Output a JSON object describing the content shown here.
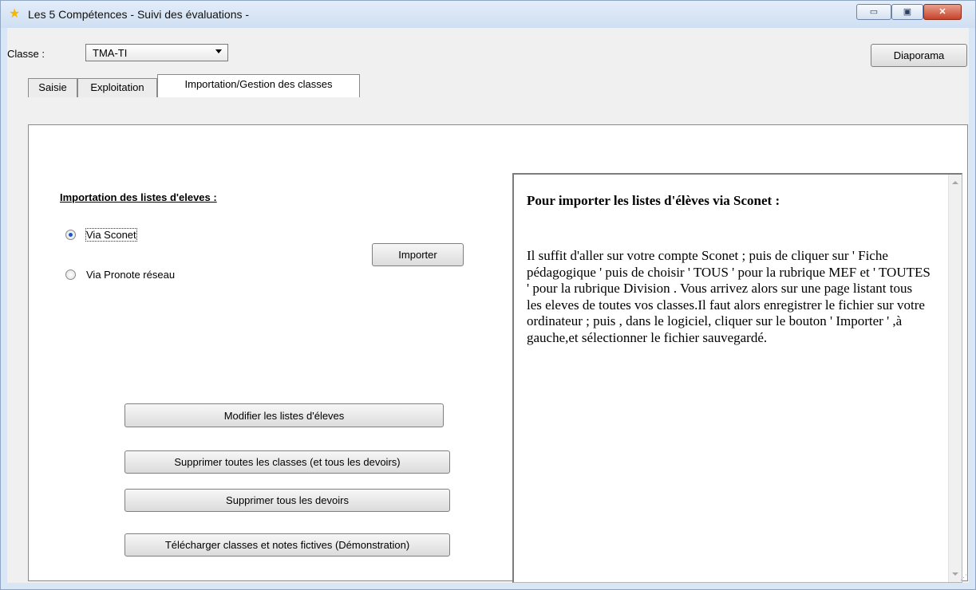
{
  "window": {
    "title": "Les 5 Compétences - Suivi des évaluations -",
    "app_icon": "star-icon",
    "controls": {
      "minimize": "▭",
      "maximize": "▣",
      "close": "✕"
    }
  },
  "toolbar": {
    "classe_label": "Classe :",
    "classe_value": "TMA-TI",
    "diaporama_label": "Diaporama"
  },
  "tabs": [
    {
      "label": "Saisie",
      "active": false
    },
    {
      "label": "Exploitation",
      "active": false
    },
    {
      "label": "Importation/Gestion des classes",
      "active": true
    }
  ],
  "import_section": {
    "title": "Importation des listes d'eleves :",
    "options": [
      {
        "label": "Via Sconet",
        "selected": true
      },
      {
        "label": "Via Pronote réseau",
        "selected": false
      }
    ],
    "import_button": "Importer"
  },
  "actions": {
    "modify": "Modifier les listes d'éleves",
    "delete_all": "Supprimer toutes les classes (et tous les devoirs)",
    "delete_homework": "Supprimer tous les devoirs",
    "download_demo": "Télécharger classes et notes fictives (Démonstration)"
  },
  "info": {
    "title": "Pour importer les listes d'élèves via Sconet :",
    "body": "Il suffit d'aller sur votre compte Sconet ; puis de cliquer sur ' Fiche pédagogique ' puis de choisir ' TOUS ' pour la rubrique MEF et ' TOUTES ' pour la rubrique Division . Vous arrivez alors sur une page listant tous les eleves de toutes vos classes.Il faut alors enregistrer le fichier sur votre ordinateur ; puis , dans le logiciel, cliquer sur le bouton ' Importer ' ,à gauche,et sélectionner le fichier sauvegardé."
  },
  "colors": {
    "titlebar": "#cfdff2",
    "radio_selected": "#1d57c5",
    "close_button": "#c8432c"
  }
}
